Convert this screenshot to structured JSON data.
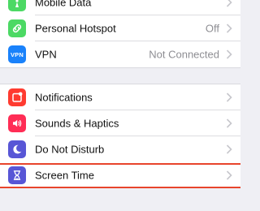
{
  "top_group": {
    "items": [
      {
        "label": "Mobile Data",
        "detail": "",
        "icon": "antenna-icon",
        "icon_color": "#4cd964"
      },
      {
        "label": "Personal Hotspot",
        "detail": "Off",
        "icon": "link-icon",
        "icon_color": "#4cd964"
      },
      {
        "label": "VPN",
        "detail": "Not Connected",
        "icon": "vpn-icon",
        "icon_text": "VPN",
        "icon_color": "#1a82fb"
      }
    ]
  },
  "mid_group": {
    "items": [
      {
        "label": "Notifications",
        "icon": "notifications-icon",
        "icon_color": "#ff3b30"
      },
      {
        "label": "Sounds & Haptics",
        "icon": "speaker-icon",
        "icon_color": "#ff2d55"
      },
      {
        "label": "Do Not Disturb",
        "icon": "moon-icon",
        "icon_color": "#5856d6"
      },
      {
        "label": "Screen Time",
        "icon": "hourglass-icon",
        "icon_color": "#5856d6"
      }
    ]
  },
  "colors": {
    "background": "#efeff4",
    "highlight": "#e8452c",
    "detail_text": "#8e8e93"
  }
}
